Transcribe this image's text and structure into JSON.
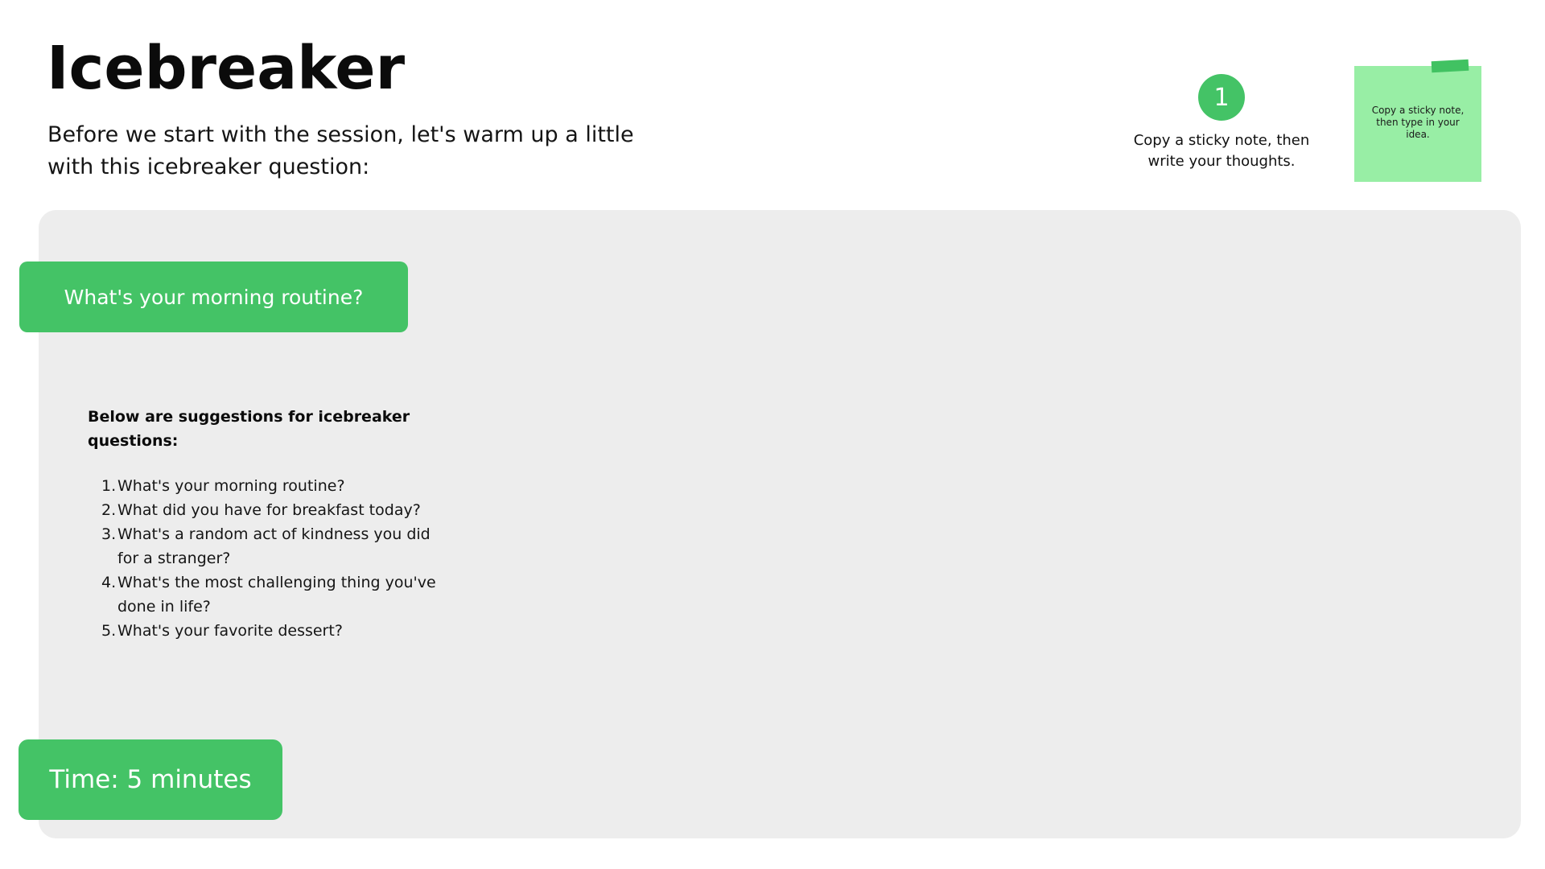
{
  "header": {
    "title": "Icebreaker",
    "subtitle": "Before we start with the session, let's warm up a little with this icebreaker question:"
  },
  "instruction": {
    "step_number": "1",
    "text": "Copy a sticky note, then write your thoughts."
  },
  "sticky_note": {
    "text": "Copy a sticky note, then type in your idea.",
    "color": "#98eea5"
  },
  "board": {
    "question": "What's your morning routine?",
    "suggestions_heading": "Below are suggestions for icebreaker questions:",
    "suggestions": [
      {
        "number": "1.",
        "text": "What's your morning routine?"
      },
      {
        "number": "2.",
        "text": "What did you have for breakfast today?"
      },
      {
        "number": "3.",
        "text": "What's a random act of kindness you did for a stranger?"
      },
      {
        "number": "4.",
        "text": "What's the most challenging thing you've done in life?"
      },
      {
        "number": "5.",
        "text": "What's your favorite dessert?"
      }
    ],
    "time_label": "Time: 5 minutes"
  },
  "colors": {
    "accent": "#44c366",
    "board_background": "#ededed"
  }
}
